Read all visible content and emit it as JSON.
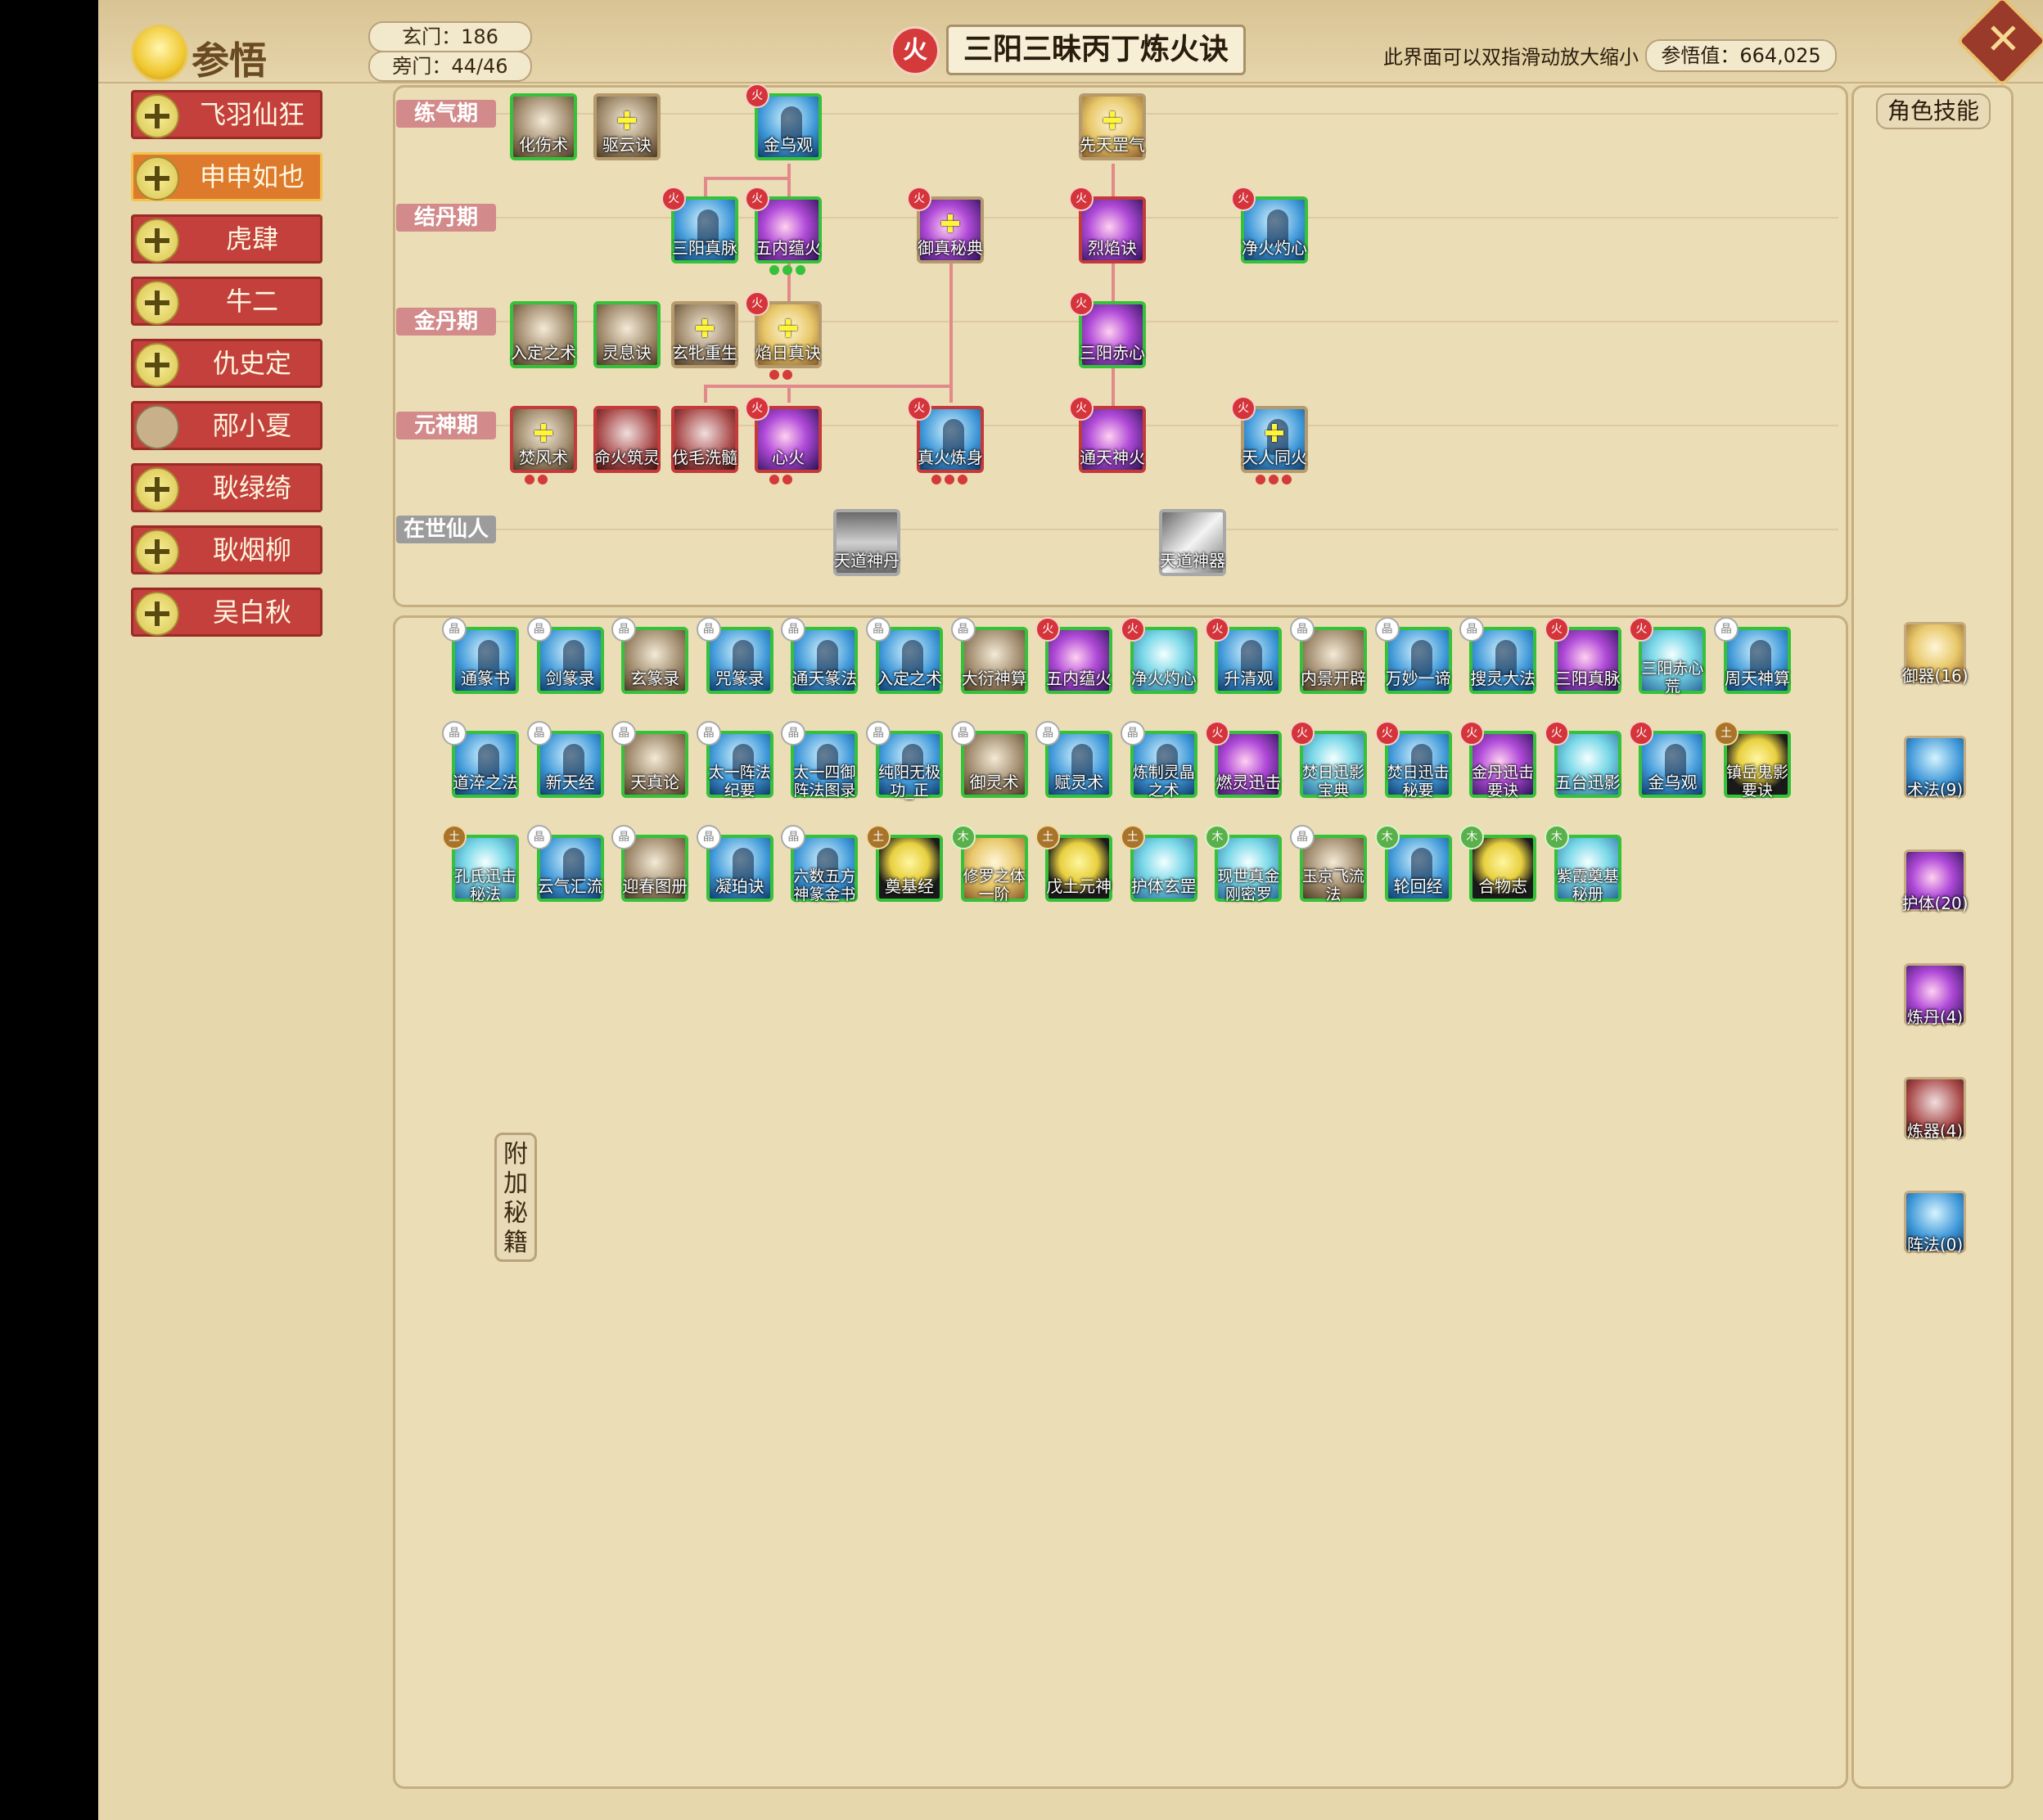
{
  "header": {
    "title": "参悟",
    "xuanmen": "玄门：186",
    "pangmen": "旁门：44/46",
    "element": "火",
    "skill_name": "三阳三昧丙丁炼火诀",
    "hint": "此界面可以双指滑动放大缩小",
    "insight": "参悟值：664,025"
  },
  "sidebar": {
    "characters": [
      {
        "name": "飞羽仙狂",
        "selected": false
      },
      {
        "name": "申申如也",
        "selected": true
      },
      {
        "name": "虎肆",
        "selected": false
      },
      {
        "name": "牛二",
        "selected": false
      },
      {
        "name": "仇史定",
        "selected": false
      },
      {
        "name": "邴小夏",
        "selected": false
      },
      {
        "name": "耿绿绮",
        "selected": false
      },
      {
        "name": "耿烟柳",
        "selected": false
      },
      {
        "name": "吴白秋",
        "selected": false
      }
    ]
  },
  "tree": {
    "realms": [
      "练气期",
      "结丹期",
      "金丹期",
      "元神期",
      "在世仙人"
    ],
    "nodes": [
      {
        "name": "化伤术",
        "icon": "brown"
      },
      {
        "name": "驱云诀",
        "icon": "brown"
      },
      {
        "name": "金乌观",
        "icon": "blue"
      },
      {
        "name": "先天罡气",
        "icon": "gold"
      },
      {
        "name": "三阳真脉",
        "icon": "blue"
      },
      {
        "name": "五内蕴火",
        "icon": "purple"
      },
      {
        "name": "御真秘典",
        "icon": "purple"
      },
      {
        "name": "烈焰诀",
        "icon": "purple"
      },
      {
        "name": "净火灼心",
        "icon": "blue"
      },
      {
        "name": "入定之术",
        "icon": "brown"
      },
      {
        "name": "灵息诀",
        "icon": "brown"
      },
      {
        "name": "玄牝重生",
        "icon": "brown"
      },
      {
        "name": "焰日真诀",
        "icon": "gold"
      },
      {
        "name": "三阳赤心",
        "icon": "purple"
      },
      {
        "name": "焚风术",
        "icon": "brown"
      },
      {
        "name": "命火筑灵",
        "icon": "darkred"
      },
      {
        "name": "伐毛洗髓",
        "icon": "darkred"
      },
      {
        "name": "心火",
        "icon": "purple"
      },
      {
        "name": "真火炼身",
        "icon": "blue"
      },
      {
        "name": "通天神火",
        "icon": "purple"
      },
      {
        "name": "天人同火",
        "icon": "blue"
      },
      {
        "name": "天道神丹",
        "icon": "gray"
      },
      {
        "name": "天道神器",
        "icon": "silver"
      }
    ]
  },
  "books": [
    {
      "name": "通篆书",
      "elem": "晶"
    },
    {
      "name": "剑篆录",
      "elem": "晶"
    },
    {
      "name": "玄篆录",
      "elem": "晶"
    },
    {
      "name": "咒篆录",
      "elem": "晶"
    },
    {
      "name": "通天篆法",
      "elem": "晶"
    },
    {
      "name": "入定之术",
      "elem": "晶"
    },
    {
      "name": "大衍神算",
      "elem": "晶"
    },
    {
      "name": "五内蕴火",
      "elem": "火"
    },
    {
      "name": "净火灼心",
      "elem": "火"
    },
    {
      "name": "升清观",
      "elem": "火"
    },
    {
      "name": "内景开辟",
      "elem": "晶"
    },
    {
      "name": "万妙一谛",
      "elem": "晶"
    },
    {
      "name": "搜灵大法",
      "elem": "晶"
    },
    {
      "name": "三阳真脉",
      "elem": "火"
    },
    {
      "name": "三阳赤心荒",
      "elem": "火"
    },
    {
      "name": "周天神算",
      "elem": "晶"
    },
    {
      "name": "道淬之法",
      "elem": "晶"
    },
    {
      "name": "新天经",
      "elem": "晶"
    },
    {
      "name": "天真论",
      "elem": "晶"
    },
    {
      "name": "太一阵法纪要",
      "elem": "晶"
    },
    {
      "name": "太一四御阵法图录",
      "elem": "晶"
    },
    {
      "name": "纯阳无极功_正",
      "elem": "晶"
    },
    {
      "name": "御灵术",
      "elem": "晶"
    },
    {
      "name": "赋灵术",
      "elem": "晶"
    },
    {
      "name": "炼制灵晶之术",
      "elem": "晶"
    },
    {
      "name": "燃灵迅击",
      "elem": "火"
    },
    {
      "name": "焚日迅影宝典",
      "elem": "火"
    },
    {
      "name": "焚日迅击秘要",
      "elem": "火"
    },
    {
      "name": "金丹迅击要诀",
      "elem": "火"
    },
    {
      "name": "五台迅影",
      "elem": "火"
    },
    {
      "name": "金乌观",
      "elem": "火"
    },
    {
      "name": "镇岳鬼影要诀",
      "elem": "土"
    },
    {
      "name": "孔氏迅击秘法",
      "elem": "土"
    },
    {
      "name": "云气汇流",
      "elem": "晶"
    },
    {
      "name": "迎春图册",
      "elem": "晶"
    },
    {
      "name": "凝珀诀",
      "elem": "晶"
    },
    {
      "name": "六数五方神篆金书",
      "elem": "晶"
    },
    {
      "name": "奠基经",
      "elem": "土"
    },
    {
      "name": "修罗之体一阶",
      "elem": "木"
    },
    {
      "name": "戊土元神",
      "elem": "土"
    },
    {
      "name": "护体玄罡",
      "elem": "土"
    },
    {
      "name": "现世真金刚密罗",
      "elem": "木"
    },
    {
      "name": "玉京飞流法",
      "elem": "晶"
    },
    {
      "name": "轮回经",
      "elem": "木"
    },
    {
      "name": "合物志",
      "elem": "木"
    },
    {
      "name": "紫霞奠基秘册",
      "elem": "木"
    }
  ],
  "extra_tab": "附加秘籍",
  "role_skills": {
    "title": "角色技能",
    "items": [
      "御器(16)",
      "术法(9)",
      "护体(20)",
      "炼丹(4)",
      "炼器(4)",
      "阵法(0)"
    ]
  }
}
